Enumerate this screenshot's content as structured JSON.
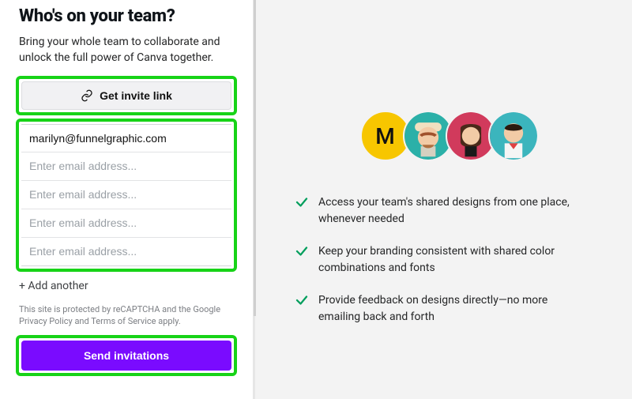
{
  "heading": "Who's on your team?",
  "subheading": "Bring your whole team to collaborate and unlock the full power of Canva together.",
  "inviteLinkLabel": "Get invite link",
  "emails": {
    "value0": "marilyn@funnelgraphic.com",
    "placeholder": "Enter email address..."
  },
  "addAnother": "+ Add another",
  "legal": "This site is protected by reCAPTCHA and the Google Privacy Policy and Terms of Service apply.",
  "sendLabel": "Send invitations",
  "avatarLetter": "M",
  "bullets": {
    "b0": "Access your team's shared designs from one place, whenever needed",
    "b1": "Keep your branding consistent with shared color combinations and fonts",
    "b2": "Provide feedback on designs directly—no more emailing back and forth"
  }
}
